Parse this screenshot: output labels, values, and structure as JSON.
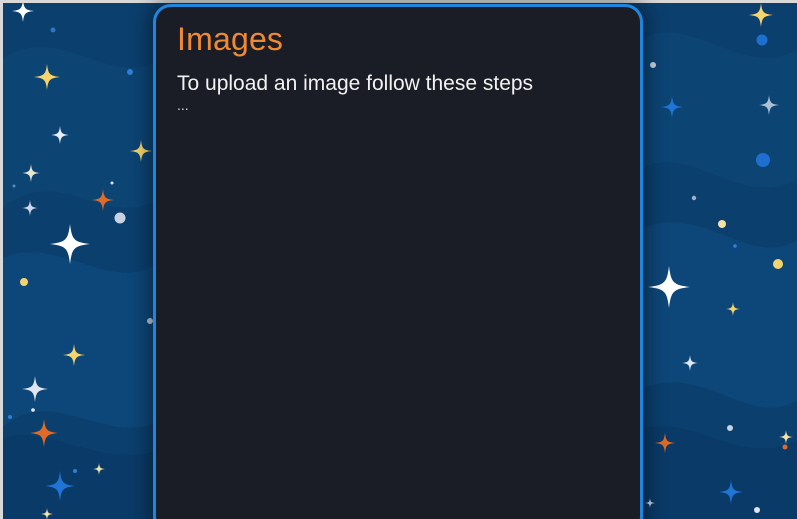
{
  "panel": {
    "title": "Images",
    "instruction": "To upload an image follow these steps",
    "ellipsis": "..."
  },
  "colors": {
    "background": "#0b3f6e",
    "panel": "#1b1d26",
    "panel_border": "#1f86e0",
    "title": "#f08a32",
    "text": "#f2f2f2"
  }
}
